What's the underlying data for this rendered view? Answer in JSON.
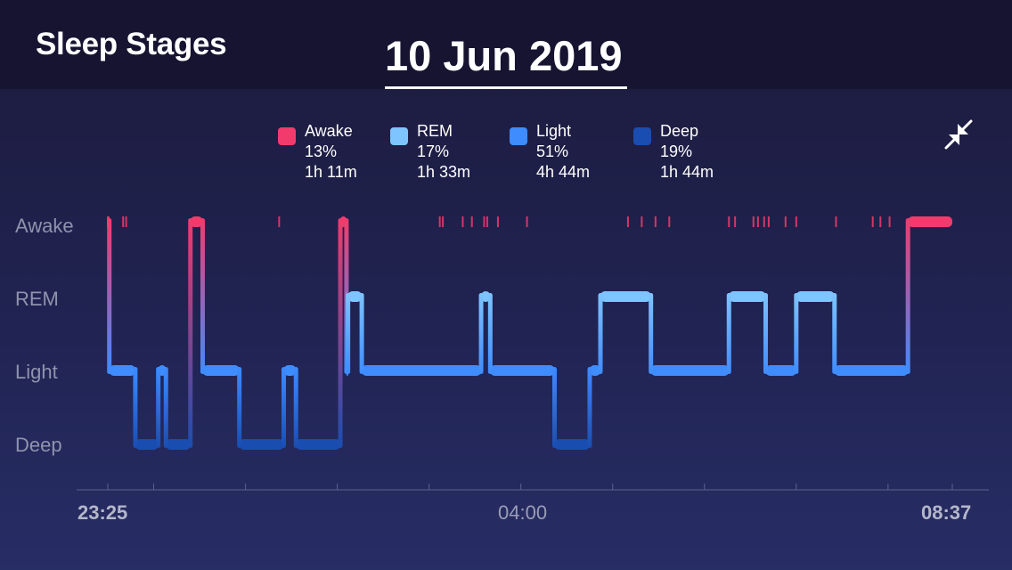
{
  "header": {
    "title": "Sleep Stages",
    "date": "10 Jun 2019"
  },
  "legend": [
    {
      "name": "Awake",
      "percent": "13%",
      "duration": "1h 11m",
      "color": "#f23b6c"
    },
    {
      "name": "REM",
      "percent": "17%",
      "duration": "1h 33m",
      "color": "#7ec4ff"
    },
    {
      "name": "Light",
      "percent": "51%",
      "duration": "4h 44m",
      "color": "#3f8cff"
    },
    {
      "name": "Deep",
      "percent": "19%",
      "duration": "1h 44m",
      "color": "#1a4db0"
    }
  ],
  "controls": {
    "collapse_icon": "collapse-arrows-icon"
  },
  "chart_data": {
    "type": "line",
    "stages": [
      "Awake",
      "REM",
      "Light",
      "Deep"
    ],
    "x_tick_labels": [
      "23:25",
      "04:00",
      "08:37"
    ],
    "x_range_minutes": [
      0,
      552
    ],
    "segments": [
      {
        "stage": "Awake",
        "start": 0,
        "end": 1
      },
      {
        "stage": "Light",
        "start": 1,
        "end": 18
      },
      {
        "stage": "Deep",
        "start": 18,
        "end": 33
      },
      {
        "stage": "Light",
        "start": 33,
        "end": 38
      },
      {
        "stage": "Deep",
        "start": 38,
        "end": 54
      },
      {
        "stage": "Awake",
        "start": 54,
        "end": 62
      },
      {
        "stage": "Light",
        "start": 62,
        "end": 86
      },
      {
        "stage": "Deep",
        "start": 86,
        "end": 115
      },
      {
        "stage": "Light",
        "start": 115,
        "end": 123
      },
      {
        "stage": "Deep",
        "start": 123,
        "end": 152
      },
      {
        "stage": "Awake",
        "start": 152,
        "end": 156
      },
      {
        "stage": "Light",
        "start": 156,
        "end": 157
      },
      {
        "stage": "REM",
        "start": 157,
        "end": 166
      },
      {
        "stage": "Light",
        "start": 166,
        "end": 244
      },
      {
        "stage": "REM",
        "start": 244,
        "end": 250
      },
      {
        "stage": "Light",
        "start": 250,
        "end": 292
      },
      {
        "stage": "Deep",
        "start": 292,
        "end": 315
      },
      {
        "stage": "Light",
        "start": 315,
        "end": 322
      },
      {
        "stage": "REM",
        "start": 322,
        "end": 355
      },
      {
        "stage": "Light",
        "start": 355,
        "end": 406
      },
      {
        "stage": "REM",
        "start": 406,
        "end": 430
      },
      {
        "stage": "Light",
        "start": 430,
        "end": 450
      },
      {
        "stage": "REM",
        "start": 450,
        "end": 475
      },
      {
        "stage": "Light",
        "start": 475,
        "end": 523
      },
      {
        "stage": "Awake",
        "start": 523,
        "end": 552
      }
    ],
    "brief_awakenings": [
      0,
      10,
      12,
      112,
      217,
      219,
      232,
      238,
      246,
      248,
      255,
      274,
      340,
      349,
      358,
      367,
      406,
      410,
      422,
      425,
      429,
      432,
      443,
      450,
      476,
      500,
      505,
      511
    ]
  }
}
